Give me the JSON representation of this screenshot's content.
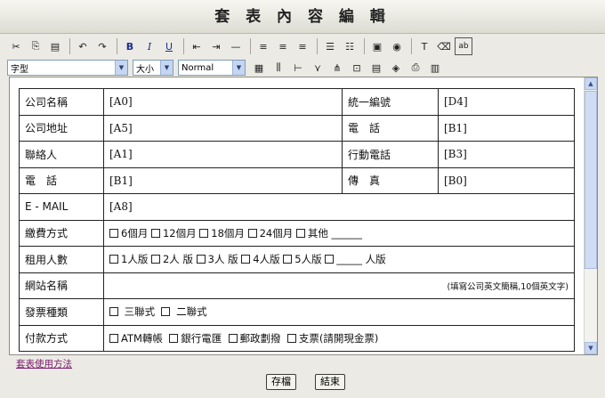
{
  "title": "套 表 內 容 編 輯",
  "toolbar": {
    "row1": [
      {
        "name": "cut",
        "glyph": "✂"
      },
      {
        "name": "copy",
        "glyph": "⎘"
      },
      {
        "name": "paste",
        "glyph": "📋"
      },
      {
        "name": "undo",
        "glyph": "↶"
      },
      {
        "name": "redo",
        "glyph": "↷"
      },
      {
        "name": "bold",
        "glyph": "B"
      },
      {
        "name": "italic",
        "glyph": "I"
      },
      {
        "name": "underline",
        "glyph": "U"
      },
      {
        "name": "outdent",
        "glyph": "⇤"
      },
      {
        "name": "indent",
        "glyph": "⇥"
      },
      {
        "name": "horizontal-rule",
        "glyph": "—"
      },
      {
        "name": "align-left",
        "glyph": "≡"
      },
      {
        "name": "align-center",
        "glyph": "≡"
      },
      {
        "name": "align-right",
        "glyph": "≡"
      },
      {
        "name": "bullet-list",
        "glyph": "☰"
      },
      {
        "name": "numbered-list",
        "glyph": "☷"
      },
      {
        "name": "insert-image",
        "glyph": "▣"
      },
      {
        "name": "insert-link",
        "glyph": "◉"
      },
      {
        "name": "text-color",
        "glyph": "T"
      },
      {
        "name": "eraser",
        "glyph": "⌫"
      },
      {
        "name": "text-field",
        "glyph": "ab"
      }
    ],
    "font_select": "字型",
    "size_select": "大小",
    "style_select": "Normal",
    "row2": [
      {
        "name": "insert-table",
        "glyph": "▦"
      },
      {
        "name": "insert-column",
        "glyph": "⫼"
      },
      {
        "name": "insert-row",
        "glyph": "⊢"
      },
      {
        "name": "merge-cells",
        "glyph": "⋎"
      },
      {
        "name": "split-cells",
        "glyph": "⋔"
      },
      {
        "name": "cell-properties",
        "glyph": "⊡"
      },
      {
        "name": "table-properties",
        "glyph": "▤"
      },
      {
        "name": "fill-color",
        "glyph": "◈"
      },
      {
        "name": "print",
        "glyph": "⎙"
      },
      {
        "name": "grid",
        "glyph": "▥"
      }
    ]
  },
  "form": {
    "company_name_label": "公司名稱",
    "company_name_value": "[A0]",
    "tax_id_label": "統一編號",
    "tax_id_value": "[D4]",
    "address_label": "公司地址",
    "address_value": "[A5]",
    "phone_label": "電　話",
    "phone_value": "[B1]",
    "contact_label": "聯絡人",
    "contact_value": "[A1]",
    "mobile_label": "行動電話",
    "mobile_value": "[B3]",
    "phone2_label": "電　話",
    "phone2_value": "[B1]",
    "fax_label": "傳　真",
    "fax_value": "[B0]",
    "email_label": "E - MAIL",
    "email_value": "[A8]",
    "payment_period_label": "繳費方式",
    "payment_period_options": [
      "6個月",
      "12個月",
      "18個月",
      "24個月",
      "其他 ______"
    ],
    "users_label": "租用人數",
    "users_options": [
      "1人版",
      "2人 版",
      "3人 版",
      "4人版",
      "5人版",
      "_____ 人版"
    ],
    "site_name_label": "網站名稱",
    "site_name_note": "(填寫公司英文簡稱,10個英文字)",
    "invoice_label": "發票種類",
    "invoice_options": [
      "三聯式",
      "二聯式"
    ],
    "pay_method_label": "付款方式",
    "pay_method_options": [
      "ATM轉帳",
      "銀行電匯",
      "郵政劃撥",
      "支票(請開現金票)"
    ]
  },
  "usage_link": "套表使用方法",
  "save_button": "存檔",
  "close_button": "結束"
}
